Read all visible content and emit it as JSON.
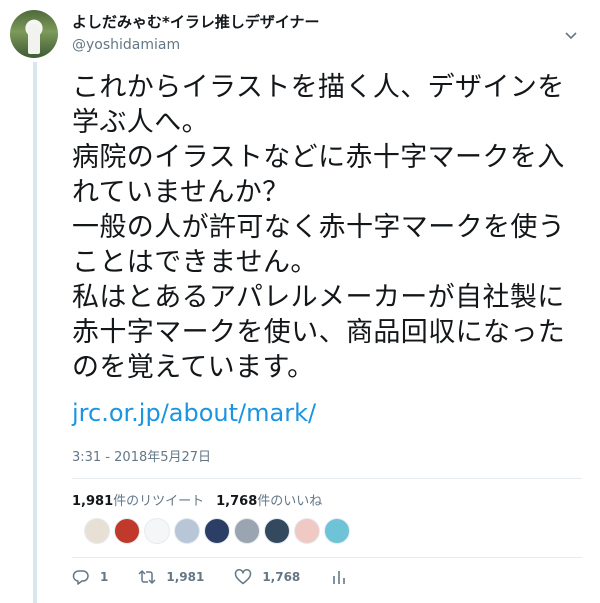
{
  "user": {
    "display_name": "よしだみゃむ*イラレ推しデザイナー",
    "username": "@yoshidamiam"
  },
  "tweet": {
    "text": "これからイラストを描く人、デザインを\n学ぶ人へ。\n病院のイラストなどに赤十字マークを入\nれていませんか？\n一般の人が許可なく赤十字マークを使う\nことはできません。\n私はとあるアパレルメーカーが自社製に\n赤十字マークを使い、商品回収になった\nのを覚えています。",
    "link": "jrc.or.jp/about/mark/",
    "timestamp": "3:31 - 2018年5月27日"
  },
  "stats": {
    "retweets_count": "1,981",
    "retweets_label": "件のリツイート",
    "likes_count": "1,768",
    "likes_label": "件のいいね"
  },
  "likers": [
    {
      "color": "#e8e0d5"
    },
    {
      "color": "#c0392b"
    },
    {
      "color": "#f4f6f8"
    },
    {
      "color": "#b8c6d8"
    },
    {
      "color": "#2c3e66"
    },
    {
      "color": "#9aa5b1"
    },
    {
      "color": "#34495e"
    },
    {
      "color": "#f0c9c4"
    },
    {
      "color": "#6fc3d6"
    }
  ],
  "actions": {
    "reply_count": "1",
    "retweet_count": "1,981",
    "like_count": "1,768"
  },
  "icons": [
    "chevron-down-icon",
    "reply-icon",
    "retweet-icon",
    "like-icon",
    "analytics-icon"
  ]
}
